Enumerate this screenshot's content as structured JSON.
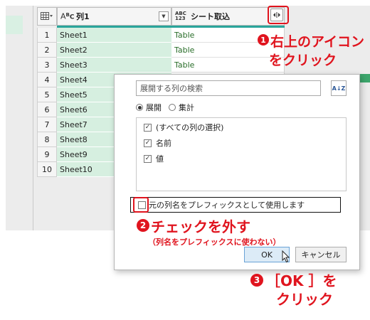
{
  "grid": {
    "columns": [
      {
        "type_top": "A",
        "type_bottom": "B",
        "type_sub": "C",
        "name": "列1"
      },
      {
        "type_top": "ABC",
        "type_bottom": "123",
        "name": "シート取込"
      }
    ],
    "rows": [
      {
        "num": "1",
        "c1": "Sheet1",
        "c2": "Table"
      },
      {
        "num": "2",
        "c1": "Sheet2",
        "c2": "Table"
      },
      {
        "num": "3",
        "c1": "Sheet3",
        "c2": "Table"
      },
      {
        "num": "4",
        "c1": "Sheet4",
        "c2": ""
      },
      {
        "num": "5",
        "c1": "Sheet5",
        "c2": ""
      },
      {
        "num": "6",
        "c1": "Sheet6",
        "c2": ""
      },
      {
        "num": "7",
        "c1": "Sheet7",
        "c2": ""
      },
      {
        "num": "8",
        "c1": "Sheet8",
        "c2": ""
      },
      {
        "num": "9",
        "c1": "Sheet9",
        "c2": ""
      },
      {
        "num": "10",
        "c1": "Sheet10",
        "c2": ""
      }
    ]
  },
  "popup": {
    "search_placeholder": "展開する列の検索",
    "sort_label": "A↓Z",
    "radio_expand": "展開",
    "radio_aggregate": "集計",
    "radio_selected": "expand",
    "column_items": [
      {
        "label": "(すべての列の選択)",
        "checked": true
      },
      {
        "label": "名前",
        "checked": true
      },
      {
        "label": "値",
        "checked": true
      }
    ],
    "prefix_label": "元の列名をプレフィックスとして使用します",
    "prefix_checked": false,
    "ok_label": "OK",
    "cancel_label": "キャンセル"
  },
  "annotations": {
    "step1_num": "1",
    "step1_line1": "右上のアイコン",
    "step1_line2": "をクリック",
    "step2_num": "2",
    "step2_title": "チェックを外す",
    "step2_sub": "（列名をプレフィックスに使わない）",
    "step3_num": "3",
    "step3_line1": "［OK ］を",
    "step3_line2": "クリック"
  },
  "colors": {
    "annotation_red": "#e0141e",
    "selected_column_green": "#d6efe0",
    "header_teal": "#2aa59b",
    "ok_button_blue": "#dcebf7"
  },
  "icons": {
    "table_menu": "table-icon",
    "expand": "expand-icon",
    "dropdown": "chevron-down-icon",
    "sort": "sort-az-icon",
    "cursor": "mouse-cursor-icon"
  }
}
